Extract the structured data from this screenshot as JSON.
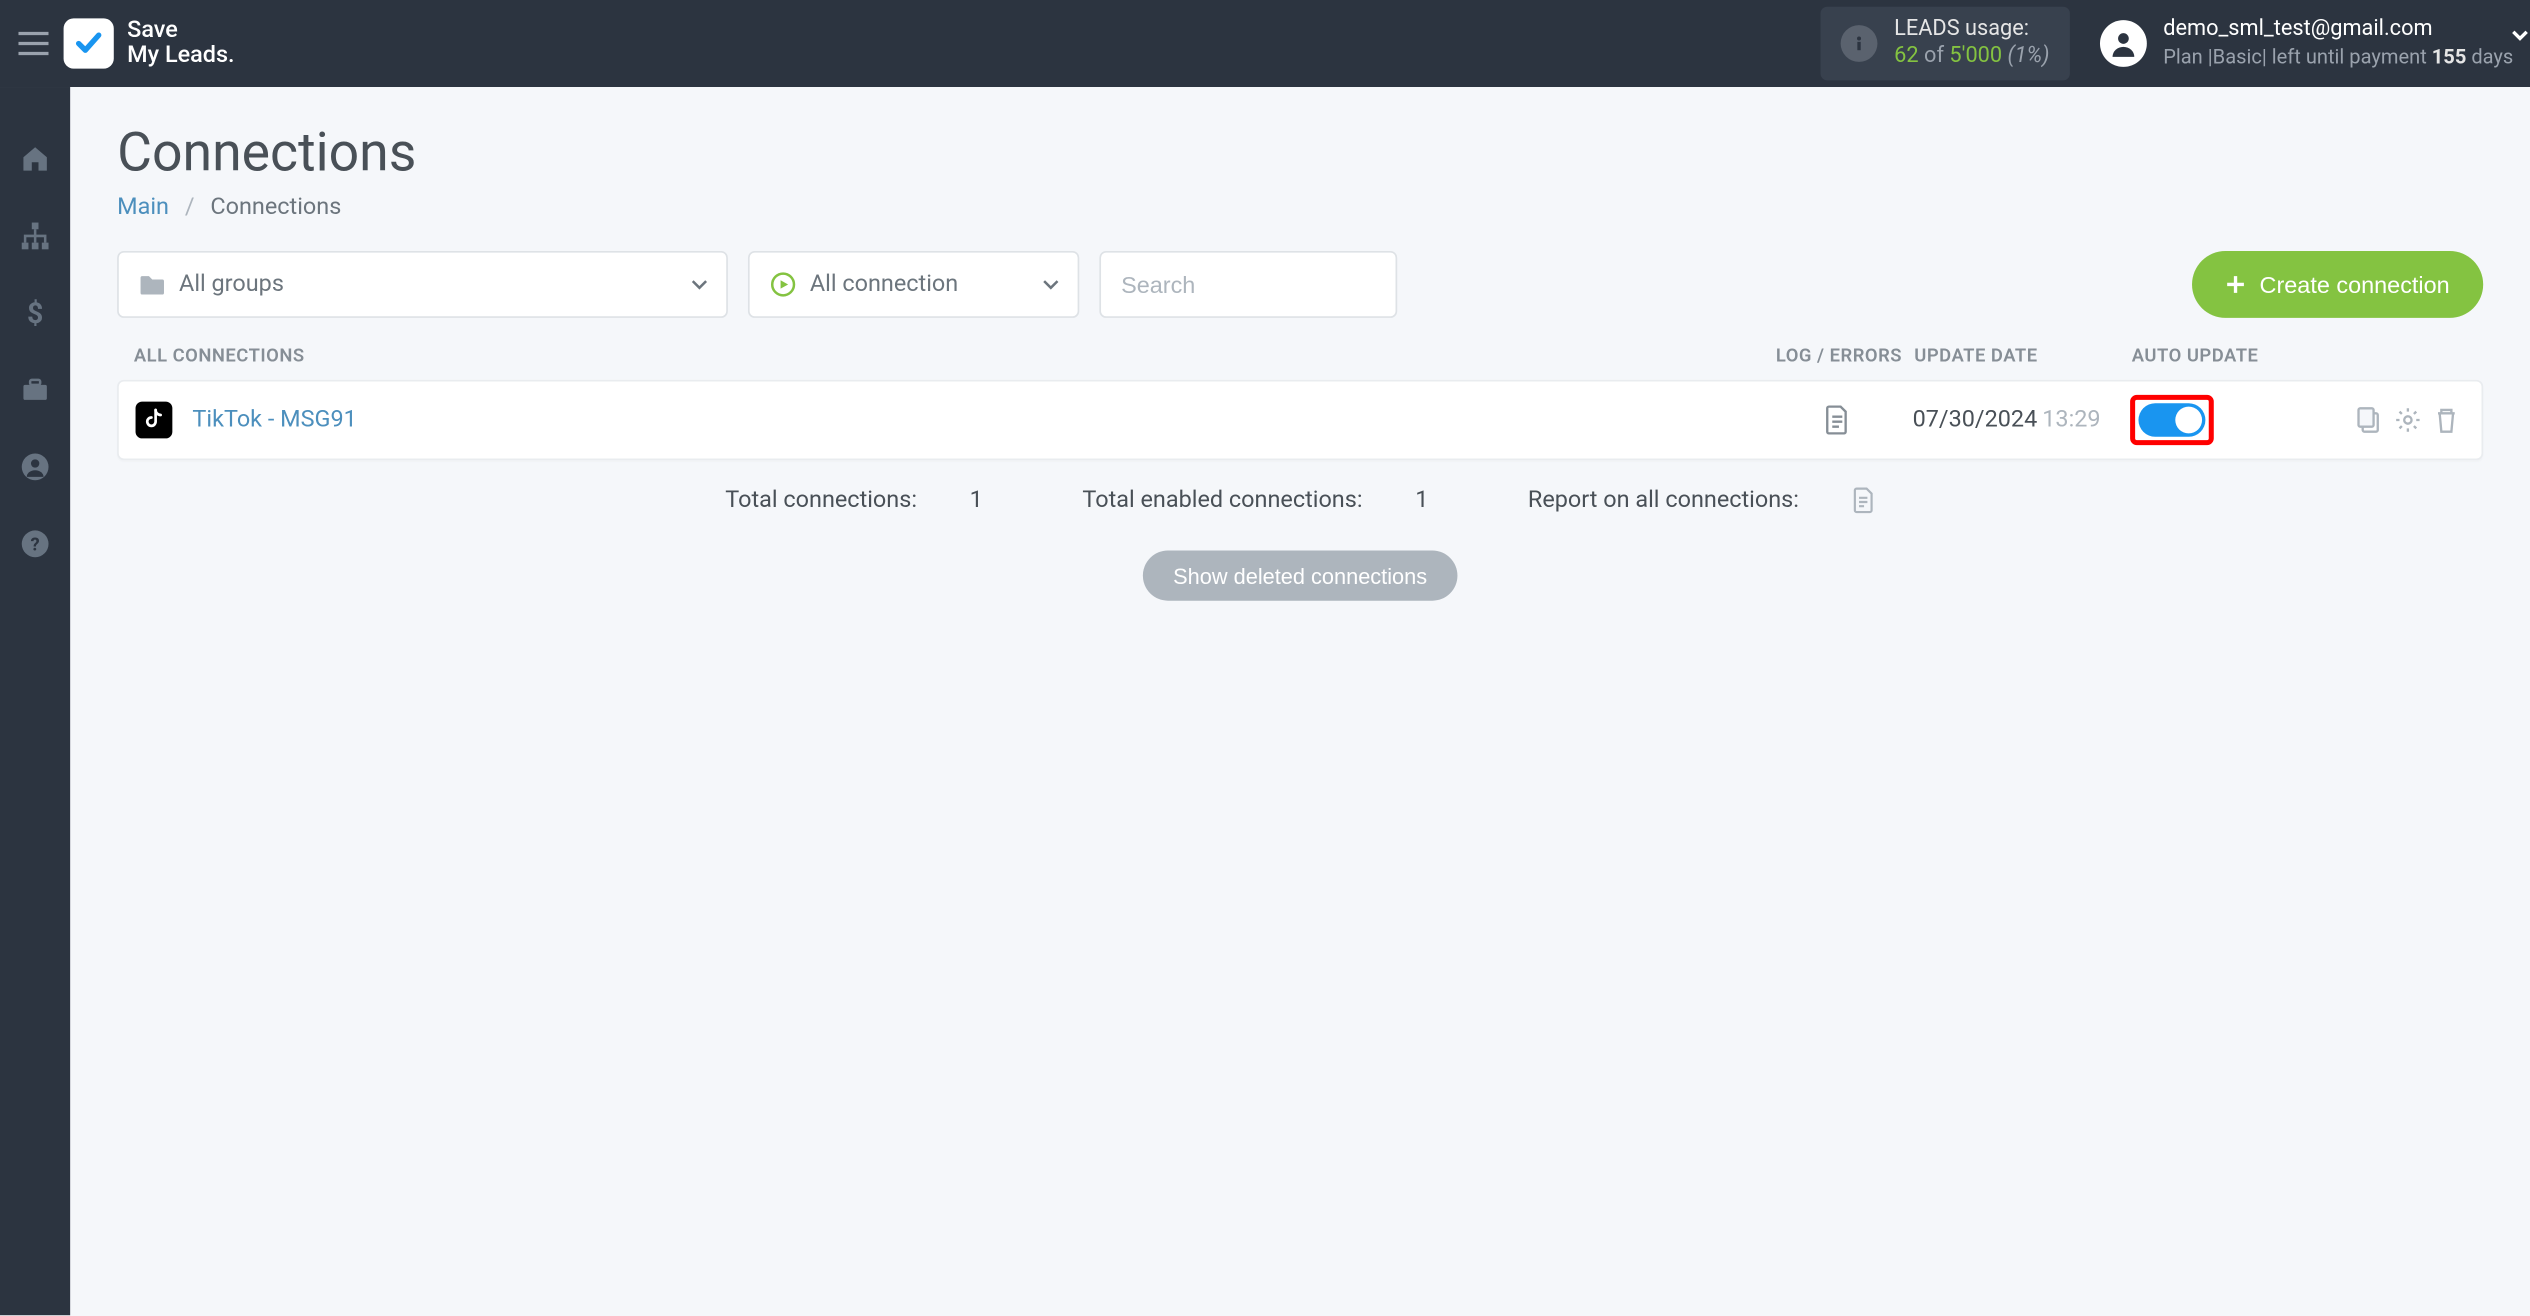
{
  "header": {
    "brand_line1": "Save",
    "brand_line2": "My Leads.",
    "leads_label": "LEADS usage:",
    "leads_used": "62",
    "leads_of": "of",
    "leads_total": "5'000",
    "leads_pct": "(1%)",
    "user_email": "demo_sml_test@gmail.com",
    "plan_prefix": "Plan |",
    "plan_name": "Basic",
    "plan_mid": "| left until payment",
    "plan_days": "155",
    "plan_suffix": "days"
  },
  "page": {
    "title": "Connections",
    "crumb_main": "Main",
    "crumb_current": "Connections"
  },
  "filters": {
    "groups_label": "All groups",
    "conn_label": "All connection",
    "search_placeholder": "Search"
  },
  "table": {
    "h_name": "ALL CONNECTIONS",
    "h_log": "LOG / ERRORS",
    "h_date": "UPDATE DATE",
    "h_auto": "AUTO UPDATE",
    "rows": [
      {
        "name": "TikTok - MSG91",
        "date": "07/30/2024",
        "time": "13:29",
        "auto_on": true
      }
    ]
  },
  "footer": {
    "total_label": "Total connections:",
    "total_val": "1",
    "enabled_label": "Total enabled connections:",
    "enabled_val": "1",
    "report_label": "Report on all connections:",
    "show_deleted": "Show deleted connections"
  },
  "buttons": {
    "create": "Create connection"
  }
}
